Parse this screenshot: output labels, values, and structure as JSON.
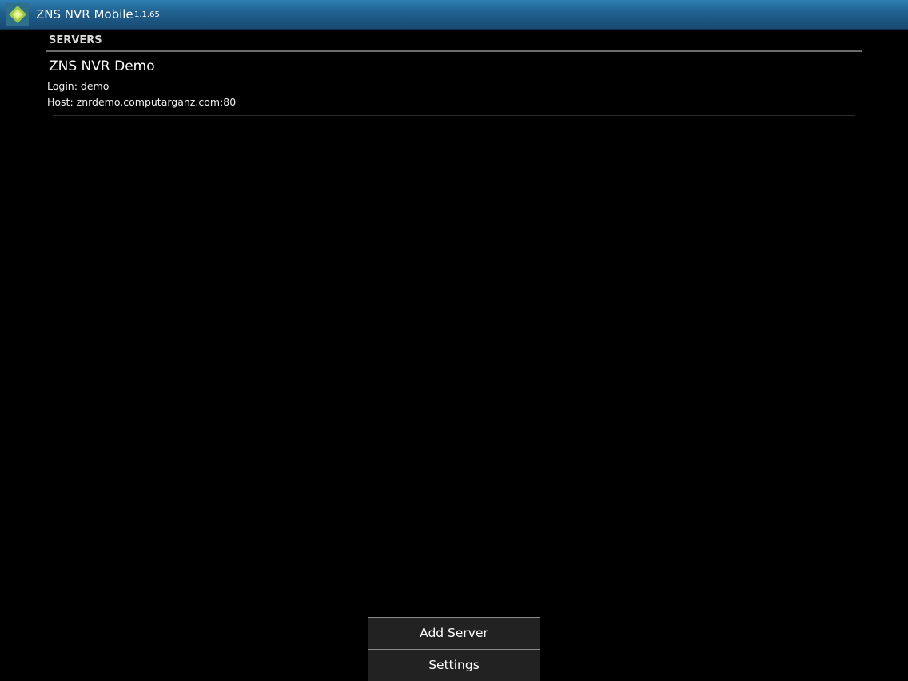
{
  "titlebar": {
    "app_icon": "app-logo-icon",
    "title": "ZNS NVR Mobile",
    "version": "1.1.65"
  },
  "servers": {
    "header": "SERVERS",
    "items": [
      {
        "name": "ZNS NVR Demo",
        "login": "Login: demo",
        "host": "Host: znrdemo.computarganz.com:80"
      }
    ]
  },
  "menu": {
    "items": [
      {
        "label": "Add Server"
      },
      {
        "label": "Settings"
      }
    ]
  },
  "colors": {
    "titlebar": "#1f5f8e",
    "background": "#000000",
    "menu_background": "#222222",
    "icon_green": "#c6e05a"
  }
}
